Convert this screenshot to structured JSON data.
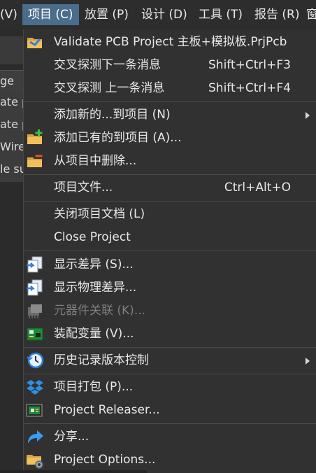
{
  "menubar": {
    "partial_item": "(V)",
    "items": [
      {
        "label": "项目 (C)"
      },
      {
        "label": "放置 (P)"
      },
      {
        "label": "设计 (D)"
      },
      {
        "label": "工具 (T)"
      },
      {
        "label": "报告 (R)"
      },
      {
        "label": "窗"
      }
    ]
  },
  "background_panel": {
    "header": "ge",
    "rows": [
      "ate p",
      "ate p",
      "Wire",
      "le su"
    ]
  },
  "menu": {
    "items": [
      {
        "label": "Validate PCB Project 主板+模拟板.PrjPcb",
        "shortcut": "",
        "icon": "validate-folder-icon"
      },
      {
        "label": "交叉探测下一条消息",
        "shortcut": "Shift+Ctrl+F3"
      },
      {
        "label": "交叉探测 上一条消息",
        "shortcut": "Shift+Ctrl+F4"
      },
      {
        "label": "添加新的...到项目 (N)",
        "submenu": true
      },
      {
        "label": "添加已有的到项目 (A)...",
        "icon": "add-existing-icon"
      },
      {
        "label": "从项目中删除...",
        "icon": "remove-from-project-icon"
      },
      {
        "label": "项目文件...",
        "shortcut": "Ctrl+Alt+O"
      },
      {
        "label": "关闭项目文档 (L)"
      },
      {
        "label": "Close Project"
      },
      {
        "label": "显示差异 (S)...",
        "icon": "show-differences-icon"
      },
      {
        "label": "显示物理差异...",
        "icon": "show-physical-differences-icon"
      },
      {
        "label": "元器件关联 (K)...",
        "disabled": true,
        "icon": "component-links-icon"
      },
      {
        "label": "装配变量 (V)...",
        "icon": "variants-icon"
      },
      {
        "label": "历史记录版本控制",
        "submenu": true,
        "icon": "history-clock-icon"
      },
      {
        "label": "项目打包 (P)...",
        "icon": "project-packager-icon"
      },
      {
        "label": "Project Releaser...",
        "icon": "project-releaser-icon"
      },
      {
        "label": "分享...",
        "icon": "share-arrow-icon"
      },
      {
        "label": "Project Options...",
        "icon": "project-options-icon"
      }
    ]
  },
  "colors": {
    "menu_bg": "#313131",
    "active_menu": "#4a6d8c",
    "text": "#e8e8e8",
    "disabled_text": "#7d7d7d"
  }
}
